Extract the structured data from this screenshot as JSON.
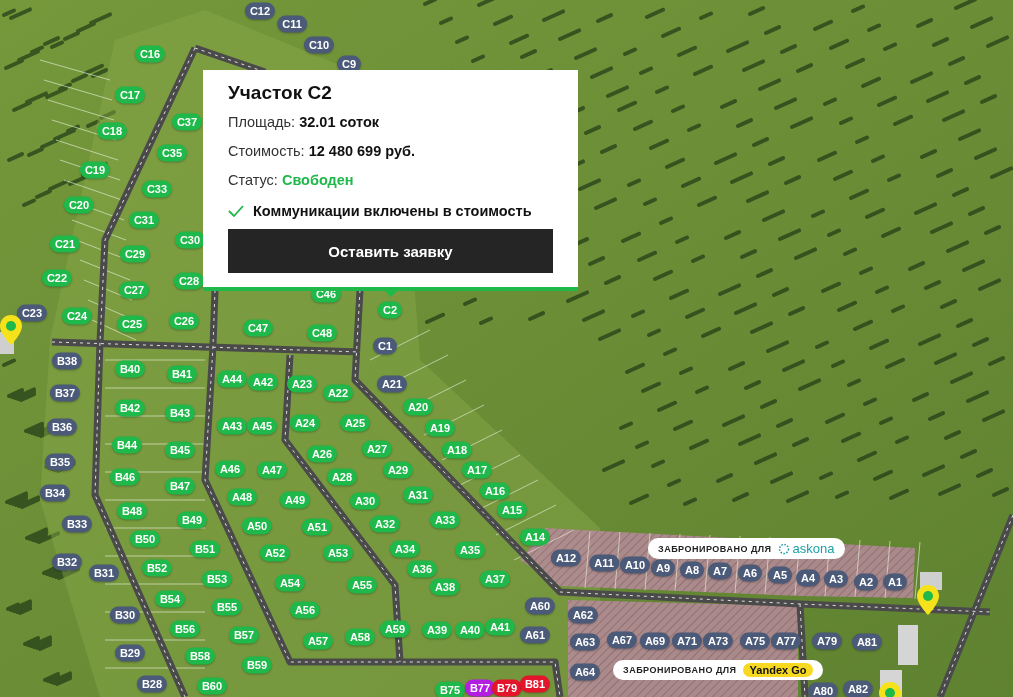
{
  "popup": {
    "title": "Участок C2",
    "rows": [
      {
        "label": "Площадь:",
        "value": "32.01 соток",
        "kind": "plain"
      },
      {
        "label": "Стоимость:",
        "value": "12 480 699 руб.",
        "kind": "plain"
      },
      {
        "label": "Статус:",
        "value": "Свободен",
        "kind": "status"
      }
    ],
    "feature": {
      "text": "Коммуникации включены в стоимость",
      "checked": true
    },
    "button": "Оставить заявку"
  },
  "banners": [
    {
      "text": "ЗАБРОНИРОВАНО ДЛЯ",
      "logo": "askona",
      "kind": "ring"
    },
    {
      "text": "ЗАБРОНИРОВАНО ДЛЯ",
      "logo": "Yandex Go",
      "kind": "pill"
    }
  ],
  "plots": [
    {
      "label": "C12",
      "color": "#4b5a78"
    },
    {
      "label": "C11",
      "color": "#4b5a78"
    },
    {
      "label": "C10",
      "color": "#4b5a78"
    },
    {
      "label": "C9",
      "color": "#4b5a78"
    },
    {
      "label": "C16",
      "color": "#1fb84a"
    },
    {
      "label": "C17",
      "color": "#1fb84a"
    },
    {
      "label": "C18",
      "color": "#1fb84a"
    },
    {
      "label": "C19",
      "color": "#1fb84a"
    },
    {
      "label": "C20",
      "color": "#1fb84a"
    },
    {
      "label": "C21",
      "color": "#1fb84a"
    },
    {
      "label": "C22",
      "color": "#1fb84a"
    },
    {
      "label": "C23",
      "color": "#4b5a78"
    },
    {
      "label": "C24",
      "color": "#1fb84a"
    },
    {
      "label": "C37",
      "color": "#1fb84a"
    },
    {
      "label": "C35",
      "color": "#1fb84a"
    },
    {
      "label": "C33",
      "color": "#1fb84a"
    },
    {
      "label": "C31",
      "color": "#1fb84a"
    },
    {
      "label": "C29",
      "color": "#1fb84a"
    },
    {
      "label": "C27",
      "color": "#1fb84a"
    },
    {
      "label": "C25",
      "color": "#1fb84a"
    },
    {
      "label": "C30",
      "color": "#1fb84a"
    },
    {
      "label": "C28",
      "color": "#1fb84a"
    },
    {
      "label": "C26",
      "color": "#1fb84a"
    },
    {
      "label": "C46",
      "color": "#1fb84a"
    },
    {
      "label": "C47",
      "color": "#1fb84a"
    },
    {
      "label": "C48",
      "color": "#1fb84a"
    },
    {
      "label": "C2",
      "color": "#1fb84a"
    },
    {
      "label": "C1",
      "color": "#4b5a78"
    },
    {
      "label": "B38",
      "color": "#4b5a78"
    },
    {
      "label": "B37",
      "color": "#4b5a78"
    },
    {
      "label": "B36",
      "color": "#4b5a78"
    },
    {
      "label": "B35",
      "color": "#4b5a78"
    },
    {
      "label": "B34",
      "color": "#4b5a78"
    },
    {
      "label": "B33",
      "color": "#4b5a78"
    },
    {
      "label": "B32",
      "color": "#4b5a78"
    },
    {
      "label": "B31",
      "color": "#4b5a78"
    },
    {
      "label": "B30",
      "color": "#4b5a78"
    },
    {
      "label": "B29",
      "color": "#4b5a78"
    },
    {
      "label": "B28",
      "color": "#4b5a78"
    },
    {
      "label": "B40",
      "color": "#1fb84a"
    },
    {
      "label": "B41",
      "color": "#1fb84a"
    },
    {
      "label": "B42",
      "color": "#1fb84a"
    },
    {
      "label": "B43",
      "color": "#1fb84a"
    },
    {
      "label": "B44",
      "color": "#1fb84a"
    },
    {
      "label": "B45",
      "color": "#1fb84a"
    },
    {
      "label": "B46",
      "color": "#1fb84a"
    },
    {
      "label": "B47",
      "color": "#1fb84a"
    },
    {
      "label": "B48",
      "color": "#1fb84a"
    },
    {
      "label": "B49",
      "color": "#1fb84a"
    },
    {
      "label": "B50",
      "color": "#1fb84a"
    },
    {
      "label": "B51",
      "color": "#1fb84a"
    },
    {
      "label": "B52",
      "color": "#1fb84a"
    },
    {
      "label": "B53",
      "color": "#1fb84a"
    },
    {
      "label": "B54",
      "color": "#1fb84a"
    },
    {
      "label": "B55",
      "color": "#1fb84a"
    },
    {
      "label": "B56",
      "color": "#1fb84a"
    },
    {
      "label": "B57",
      "color": "#1fb84a"
    },
    {
      "label": "B58",
      "color": "#1fb84a"
    },
    {
      "label": "B59",
      "color": "#1fb84a"
    },
    {
      "label": "B60",
      "color": "#1fb84a"
    },
    {
      "label": "A44",
      "color": "#1fb84a"
    },
    {
      "label": "A42",
      "color": "#1fb84a"
    },
    {
      "label": "A23",
      "color": "#1fb84a"
    },
    {
      "label": "A22",
      "color": "#1fb84a"
    },
    {
      "label": "A43",
      "color": "#1fb84a"
    },
    {
      "label": "A45",
      "color": "#1fb84a"
    },
    {
      "label": "A24",
      "color": "#1fb84a"
    },
    {
      "label": "A25",
      "color": "#1fb84a"
    },
    {
      "label": "A46",
      "color": "#1fb84a"
    },
    {
      "label": "A47",
      "color": "#1fb84a"
    },
    {
      "label": "A26",
      "color": "#1fb84a"
    },
    {
      "label": "A27",
      "color": "#1fb84a"
    },
    {
      "label": "A48",
      "color": "#1fb84a"
    },
    {
      "label": "A49",
      "color": "#1fb84a"
    },
    {
      "label": "A28",
      "color": "#1fb84a"
    },
    {
      "label": "A29",
      "color": "#1fb84a"
    },
    {
      "label": "A30",
      "color": "#1fb84a"
    },
    {
      "label": "A31",
      "color": "#1fb84a"
    },
    {
      "label": "A50",
      "color": "#1fb84a"
    },
    {
      "label": "A51",
      "color": "#1fb84a"
    },
    {
      "label": "A32",
      "color": "#1fb84a"
    },
    {
      "label": "A33",
      "color": "#1fb84a"
    },
    {
      "label": "A52",
      "color": "#1fb84a"
    },
    {
      "label": "A53",
      "color": "#1fb84a"
    },
    {
      "label": "A34",
      "color": "#1fb84a"
    },
    {
      "label": "A35",
      "color": "#1fb84a"
    },
    {
      "label": "A36",
      "color": "#1fb84a"
    },
    {
      "label": "A54",
      "color": "#1fb84a"
    },
    {
      "label": "A55",
      "color": "#1fb84a"
    },
    {
      "label": "A38",
      "color": "#1fb84a"
    },
    {
      "label": "A37",
      "color": "#1fb84a"
    },
    {
      "label": "A56",
      "color": "#1fb84a"
    },
    {
      "label": "A57",
      "color": "#1fb84a"
    },
    {
      "label": "A58",
      "color": "#1fb84a"
    },
    {
      "label": "A59",
      "color": "#1fb84a"
    },
    {
      "label": "A39",
      "color": "#1fb84a"
    },
    {
      "label": "A40",
      "color": "#1fb84a"
    },
    {
      "label": "A41",
      "color": "#1fb84a"
    },
    {
      "label": "A21",
      "color": "#4b5a78"
    },
    {
      "label": "A20",
      "color": "#1fb84a"
    },
    {
      "label": "A19",
      "color": "#1fb84a"
    },
    {
      "label": "A18",
      "color": "#1fb84a"
    },
    {
      "label": "A17",
      "color": "#1fb84a"
    },
    {
      "label": "A16",
      "color": "#1fb84a"
    },
    {
      "label": "A15",
      "color": "#1fb84a"
    },
    {
      "label": "A14",
      "color": "#1fb84a"
    },
    {
      "label": "A60",
      "color": "#4b5a78"
    },
    {
      "label": "A61",
      "color": "#4b5a78"
    },
    {
      "label": "A12",
      "color": "#4b5a78"
    },
    {
      "label": "A11",
      "color": "#4b5a78"
    },
    {
      "label": "A10",
      "color": "#4b5a78"
    },
    {
      "label": "A9",
      "color": "#4b5a78"
    },
    {
      "label": "A8",
      "color": "#4b5a78"
    },
    {
      "label": "A7",
      "color": "#4b5a78"
    },
    {
      "label": "A6",
      "color": "#4b5a78"
    },
    {
      "label": "A5",
      "color": "#4b5a78"
    },
    {
      "label": "A4",
      "color": "#4b5a78"
    },
    {
      "label": "A3",
      "color": "#4b5a78"
    },
    {
      "label": "A2",
      "color": "#4b5a78"
    },
    {
      "label": "A1",
      "color": "#4b5a78"
    },
    {
      "label": "A62",
      "color": "#4b5a78"
    },
    {
      "label": "A63",
      "color": "#4b5a78"
    },
    {
      "label": "A64",
      "color": "#4b5a78"
    },
    {
      "label": "A67",
      "color": "#4b5a78"
    },
    {
      "label": "A69",
      "color": "#4b5a78"
    },
    {
      "label": "A71",
      "color": "#4b5a78"
    },
    {
      "label": "A73",
      "color": "#4b5a78"
    },
    {
      "label": "A75",
      "color": "#4b5a78"
    },
    {
      "label": "A77",
      "color": "#4b5a78"
    },
    {
      "label": "A79",
      "color": "#4b5a78"
    },
    {
      "label": "A81",
      "color": "#4b5a78"
    },
    {
      "label": "B75",
      "color": "#1fb84a"
    },
    {
      "label": "B77",
      "color": "#b41ee0"
    },
    {
      "label": "B79",
      "color": "#e3152b"
    },
    {
      "label": "B81",
      "color": "#e3152b"
    },
    {
      "label": "A80",
      "color": "#4b5a78"
    },
    {
      "label": "A82",
      "color": "#4b5a78"
    }
  ]
}
